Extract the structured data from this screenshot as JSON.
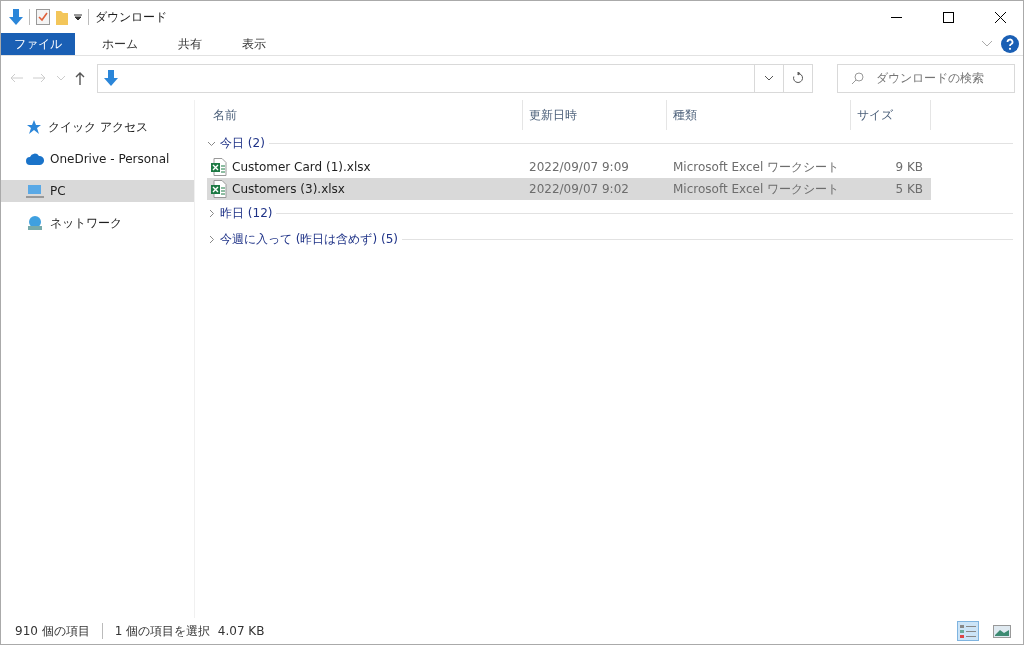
{
  "window": {
    "title": "ダウンロード"
  },
  "ribbon": {
    "tabs": [
      {
        "label": "ファイル",
        "selected": true
      },
      {
        "label": "ホーム",
        "selected": false
      },
      {
        "label": "共有",
        "selected": false
      },
      {
        "label": "表示",
        "selected": false
      }
    ]
  },
  "search": {
    "placeholder": "ダウンロードの検索"
  },
  "sidebar": {
    "items": [
      {
        "label": "クイック アクセス",
        "kind": "star",
        "selected": false
      },
      {
        "label": "OneDrive - Personal",
        "kind": "cloud",
        "selected": false
      },
      {
        "label": "PC",
        "kind": "pc",
        "selected": true
      },
      {
        "label": "ネットワーク",
        "kind": "network",
        "selected": false
      }
    ]
  },
  "table": {
    "columns": [
      "名前",
      "更新日時",
      "種類",
      "サイズ"
    ],
    "groups": [
      {
        "label": "今日 (2)",
        "expanded": true,
        "rows": [
          {
            "name": "Customer Card (1).xlsx",
            "date": "2022/09/07 9:09",
            "type": "Microsoft Excel ワークシート",
            "size": "9 KB",
            "selected": false
          },
          {
            "name": "Customers (3).xlsx",
            "date": "2022/09/07 9:02",
            "type": "Microsoft Excel ワークシート",
            "size": "5 KB",
            "selected": true
          }
        ]
      },
      {
        "label": "昨日 (12)",
        "expanded": false
      },
      {
        "label": "今週に入って (昨日は含めず) (5)",
        "expanded": false
      }
    ]
  },
  "status_bar": {
    "item_count": "910 個の項目",
    "selection": "1 個の項目を選択  4.07 KB"
  },
  "views": [
    {
      "kind": "details",
      "selected": true
    },
    {
      "kind": "tiles",
      "selected": false
    }
  ]
}
